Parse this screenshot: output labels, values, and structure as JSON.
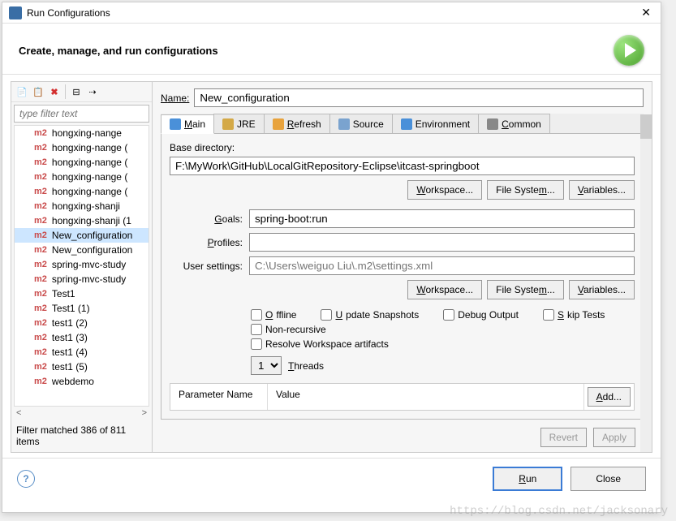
{
  "title": "Run Configurations",
  "header": "Create, manage, and run configurations",
  "filter_placeholder": "type filter text",
  "tree_items": [
    {
      "label": "hongxing-nange",
      "selected": false
    },
    {
      "label": "hongxing-nange (",
      "selected": false
    },
    {
      "label": "hongxing-nange (",
      "selected": false
    },
    {
      "label": "hongxing-nange (",
      "selected": false
    },
    {
      "label": "hongxing-nange (",
      "selected": false
    },
    {
      "label": "hongxing-shanji",
      "selected": false
    },
    {
      "label": "hongxing-shanji (1",
      "selected": false
    },
    {
      "label": "New_configuration",
      "selected": true
    },
    {
      "label": "New_configuration",
      "selected": false
    },
    {
      "label": "spring-mvc-study",
      "selected": false
    },
    {
      "label": "spring-mvc-study",
      "selected": false
    },
    {
      "label": "Test1",
      "selected": false
    },
    {
      "label": "Test1 (1)",
      "selected": false
    },
    {
      "label": "test1 (2)",
      "selected": false
    },
    {
      "label": "test1 (3)",
      "selected": false
    },
    {
      "label": "test1 (4)",
      "selected": false
    },
    {
      "label": "test1 (5)",
      "selected": false
    },
    {
      "label": "webdemo",
      "selected": false
    }
  ],
  "filter_status": "Filter matched 386 of 811 items",
  "name_label": "Name:",
  "name_value": "New_configuration",
  "tabs": [
    {
      "label": "Main",
      "active": true
    },
    {
      "label": "JRE",
      "active": false
    },
    {
      "label": "Refresh",
      "active": false
    },
    {
      "label": "Source",
      "active": false
    },
    {
      "label": "Environment",
      "active": false
    },
    {
      "label": "Common",
      "active": false
    }
  ],
  "main_tab": {
    "base_dir_label": "Base directory:",
    "base_dir_value": "F:\\MyWork\\GitHub\\LocalGitRepository-Eclipse\\itcast-springboot",
    "workspace_btn": "Workspace...",
    "filesystem_btn": "File System...",
    "variables_btn": "Variables...",
    "goals_label": "Goals:",
    "goals_value": "spring-boot:run",
    "profiles_label": "Profiles:",
    "profiles_value": "",
    "user_settings_label": "User settings:",
    "user_settings_placeholder": "C:\\Users\\weiguo Liu\\.m2\\settings.xml",
    "check_offline": "Offline",
    "check_update": "Update Snapshots",
    "check_debug": "Debug Output",
    "check_skip": "Skip Tests",
    "check_nonrec": "Non-recursive",
    "check_resolve": "Resolve Workspace artifacts",
    "threads_value": "1",
    "threads_label": "Threads",
    "param_name_header": "Parameter Name",
    "param_value_header": "Value",
    "add_btn": "Add..."
  },
  "actions": {
    "revert": "Revert",
    "apply": "Apply",
    "run": "Run",
    "close": "Close"
  },
  "watermark": "https://blog.csdn.net/jacksonary"
}
